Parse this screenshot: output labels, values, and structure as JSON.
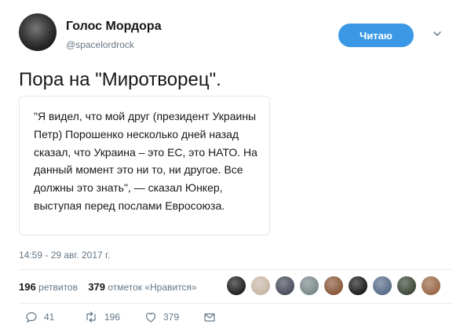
{
  "header": {
    "user_name": "Голос Мордора",
    "handle": "@spacelordrock",
    "follow_label": "Читаю"
  },
  "tweet": {
    "text": "Пора на \"Миротворец\".",
    "quote": "\"Я видел, что мой друг (президент Украины Петр) Порошенко несколько дней назад сказал, что Украина – это ЕС, это НАТО. На данный момент это ни то, ни другое. Все должны это знать\", — сказал Юнкер, выступая перед послами Евросоюза.",
    "timestamp": "14:59 - 29 авг. 2017 г."
  },
  "stats": {
    "retweets_count": "196",
    "retweets_label": "ретвитов",
    "likes_count": "379",
    "likes_label": "отметок «Нравится»"
  },
  "likers": {
    "avatar_colors": [
      "#222222",
      "#c9b8a8",
      "#4a4f5c",
      "#7d8a8c",
      "#8a5a3c",
      "#1e1e1e",
      "#5a6f8a",
      "#3e4a3a",
      "#9a6a4a"
    ]
  },
  "actions": {
    "reply_count": "41",
    "retweet_count": "196",
    "like_count": "379"
  },
  "icons": {
    "reply": "reply-icon",
    "retweet": "retweet-icon",
    "like": "heart-icon",
    "dm": "envelope-icon",
    "caret": "chevron-down-icon"
  },
  "colors": {
    "accent": "#3a98e6",
    "text": "#14171a",
    "secondary": "#657786",
    "border": "#e1e8ed"
  }
}
